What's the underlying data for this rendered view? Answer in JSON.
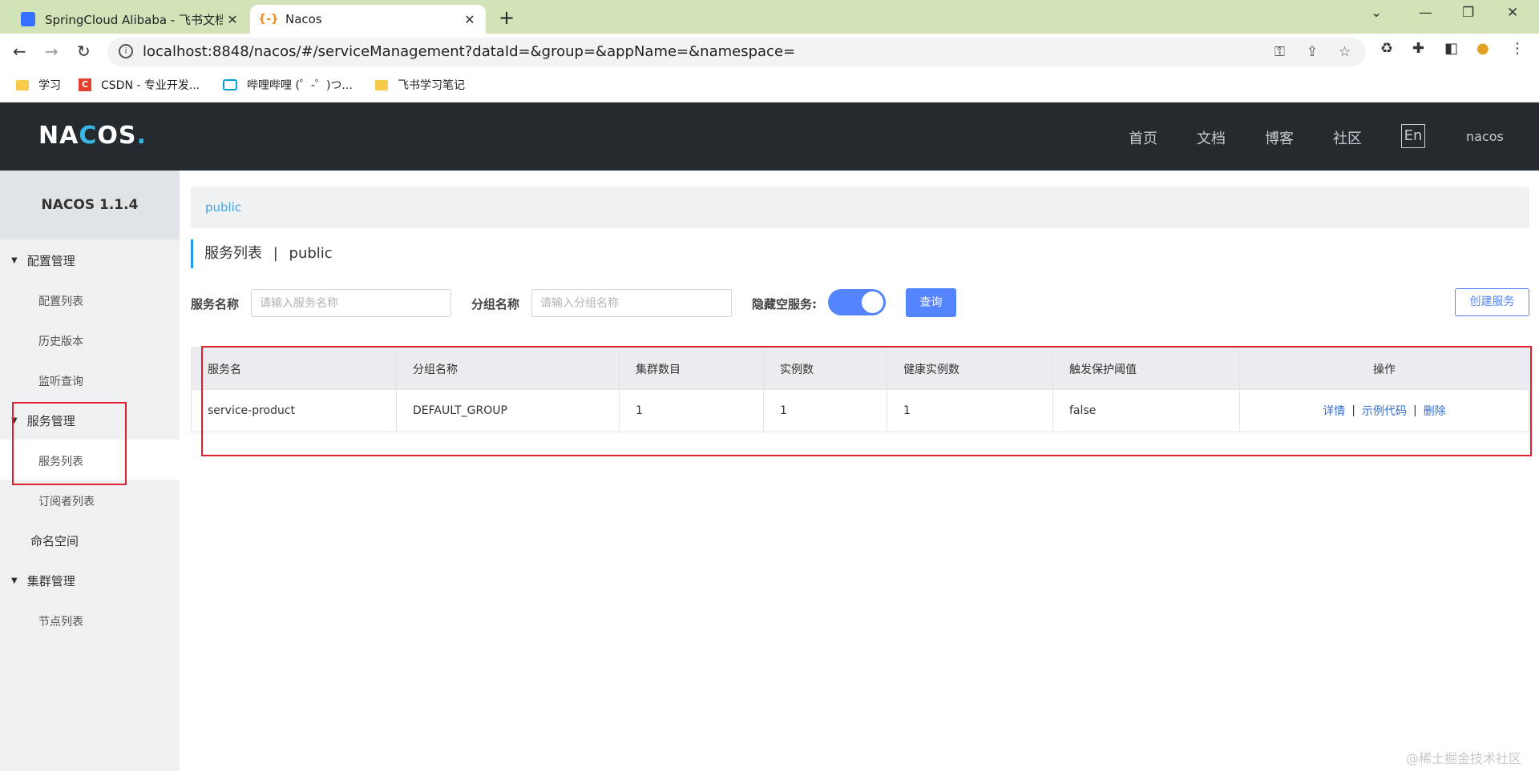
{
  "browser": {
    "tabs": [
      {
        "title": "SpringCloud Alibaba - 飞书文档",
        "active": false
      },
      {
        "title": "Nacos",
        "active": true
      }
    ],
    "url": "localhost:8848/nacos/#/serviceManagement?dataId=&group=&appName=&namespace=",
    "bookmarks": [
      {
        "label": "学习",
        "icon": "folder-icon"
      },
      {
        "label": "CSDN - 专业开发...",
        "icon": "csdn-icon"
      },
      {
        "label": "哔哩哔哩 (゜-゜)つ...",
        "icon": "bilibili-icon"
      },
      {
        "label": "飞书学习笔记",
        "icon": "folder-icon"
      }
    ]
  },
  "header": {
    "logo": "NACOS.",
    "nav": [
      "首页",
      "文档",
      "博客",
      "社区"
    ],
    "lang": "En",
    "user": "nacos"
  },
  "sidebar": {
    "version": "NACOS 1.1.4",
    "groups": [
      {
        "label": "配置管理",
        "items": [
          "配置列表",
          "历史版本",
          "监听查询"
        ]
      },
      {
        "label": "服务管理",
        "items": [
          "服务列表",
          "订阅者列表"
        ]
      },
      {
        "label": "命名空间",
        "items": []
      },
      {
        "label": "集群管理",
        "items": [
          "节点列表"
        ]
      }
    ]
  },
  "main": {
    "namespace_tab": "public",
    "title": "服务列表",
    "title_sep": "|",
    "title_ns": "public",
    "filters": {
      "service_label": "服务名称",
      "service_placeholder": "请输入服务名称",
      "group_label": "分组名称",
      "group_placeholder": "请输入分组名称",
      "hide_empty_label": "隐藏空服务:",
      "hide_empty_on": true,
      "query_button": "查询",
      "create_button": "创建服务"
    },
    "table": {
      "columns": [
        "服务名",
        "分组名称",
        "集群数目",
        "实例数",
        "健康实例数",
        "触发保护阈值",
        "操作"
      ],
      "rows": [
        {
          "name": "service-product",
          "group": "DEFAULT_GROUP",
          "clusters": "1",
          "instances": "1",
          "healthy": "1",
          "protect": "false",
          "actions": [
            "详情",
            "示例代码",
            "删除"
          ]
        }
      ]
    }
  },
  "watermark": "@稀土掘金技术社区",
  "colors": {
    "accent": "#5584ff",
    "header_bg": "#252a2f",
    "highlight": "#e01e2e"
  }
}
